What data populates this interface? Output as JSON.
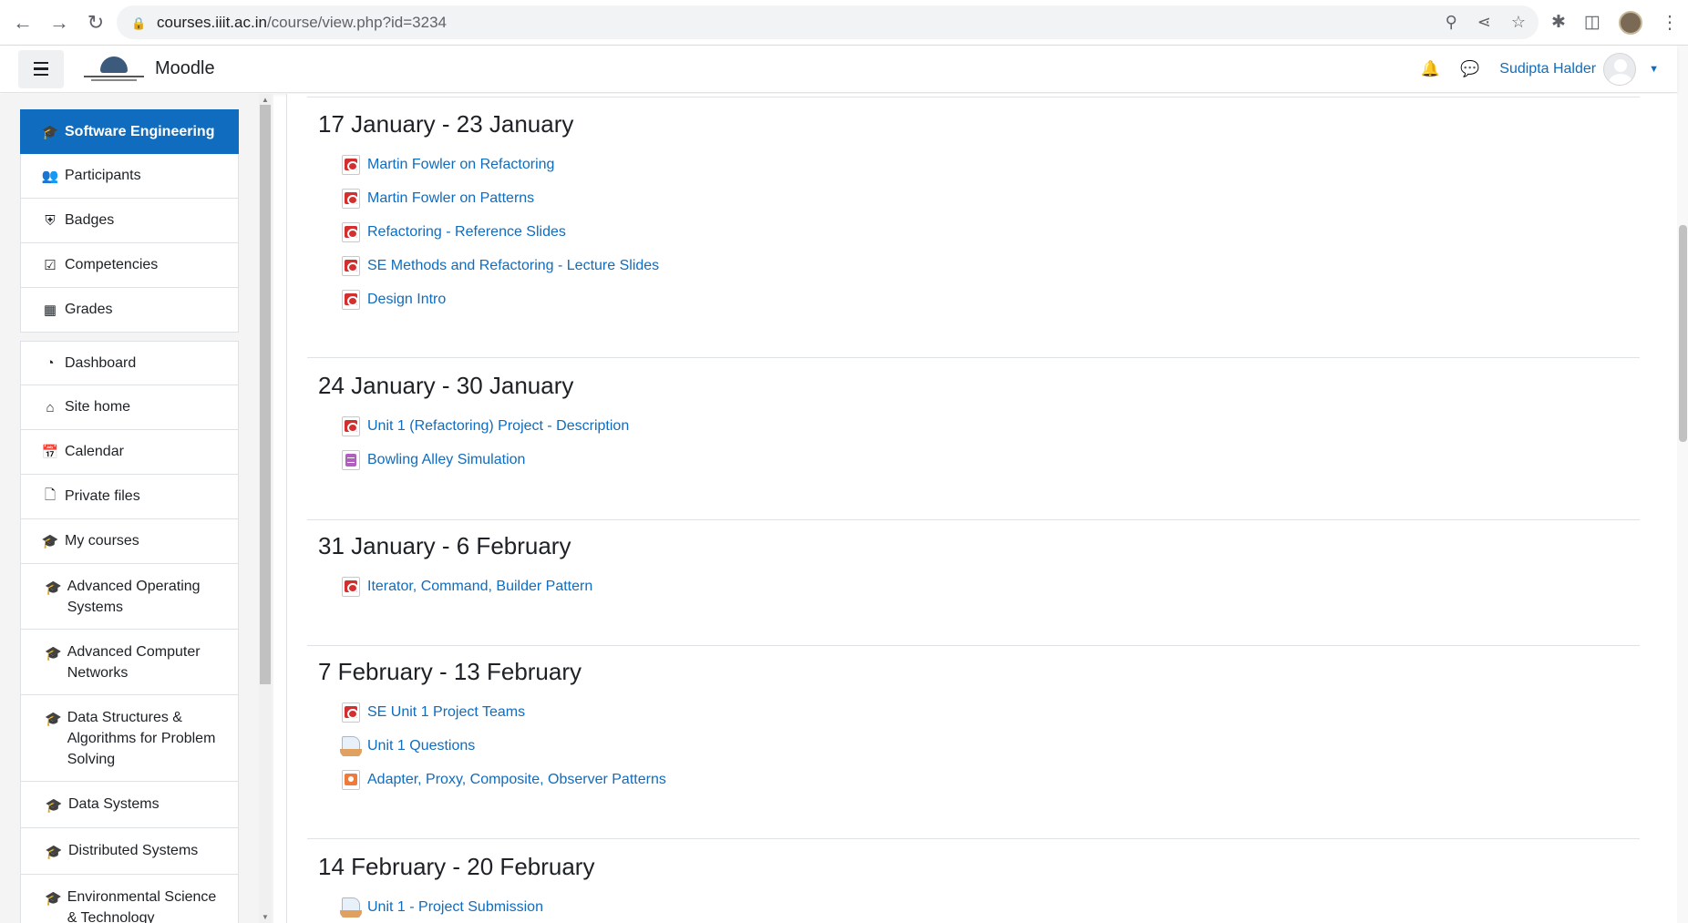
{
  "browser": {
    "url_host": "courses.iiit.ac.in",
    "url_path": "/course/view.php?id=3234"
  },
  "navbar": {
    "site_name": "Moodle",
    "user_name": "Sudipta Halder"
  },
  "sidebar": {
    "course_items": [
      {
        "label": "Software Engineering",
        "icon": "graduation-cap-icon"
      },
      {
        "label": "Participants",
        "icon": "users-icon"
      },
      {
        "label": "Badges",
        "icon": "shield-icon"
      },
      {
        "label": "Competencies",
        "icon": "check-square-icon"
      },
      {
        "label": "Grades",
        "icon": "table-icon"
      }
    ],
    "site_items": [
      {
        "label": "Dashboard",
        "icon": "dashboard-icon"
      },
      {
        "label": "Site home",
        "icon": "home-icon"
      },
      {
        "label": "Calendar",
        "icon": "calendar-icon"
      },
      {
        "label": "Private files",
        "icon": "file-icon"
      },
      {
        "label": "My courses",
        "icon": "graduation-cap-icon"
      }
    ],
    "my_courses": [
      "Advanced Operating Systems",
      "Advanced Computer Networks",
      "Data Structures & Algorithms for Problem Solving",
      "Data Systems",
      "Distributed Systems",
      "Environmental Science & Technology"
    ]
  },
  "sections": [
    {
      "title": "17 January - 23 January",
      "activities": [
        {
          "label": "Martin Fowler on Refactoring",
          "icon": "pdf-icon"
        },
        {
          "label": "Martin Fowler on Patterns",
          "icon": "pdf-icon"
        },
        {
          "label": "Refactoring - Reference Slides",
          "icon": "pdf-icon"
        },
        {
          "label": "SE Methods and Refactoring - Lecture Slides",
          "icon": "pdf-icon"
        },
        {
          "label": "Design Intro",
          "icon": "pdf-icon"
        }
      ]
    },
    {
      "title": "24 January - 30 January",
      "activities": [
        {
          "label": "Unit 1 (Refactoring) Project - Description",
          "icon": "pdf-icon"
        },
        {
          "label": "Bowling Alley Simulation",
          "icon": "document-icon"
        }
      ]
    },
    {
      "title": "31 January - 6 February",
      "activities": [
        {
          "label": "Iterator, Command, Builder Pattern",
          "icon": "pdf-icon"
        }
      ]
    },
    {
      "title": "7 February - 13 February",
      "activities": [
        {
          "label": "SE Unit 1 Project Teams",
          "icon": "pdf-icon"
        },
        {
          "label": "Unit 1 Questions",
          "icon": "assignment-icon"
        },
        {
          "label": "Adapter, Proxy, Composite, Observer Patterns",
          "icon": "presentation-icon"
        }
      ]
    },
    {
      "title": "14 February - 20 February",
      "activities": [
        {
          "label": "Unit 1 - Project Submission",
          "icon": "assignment-icon"
        }
      ]
    }
  ]
}
